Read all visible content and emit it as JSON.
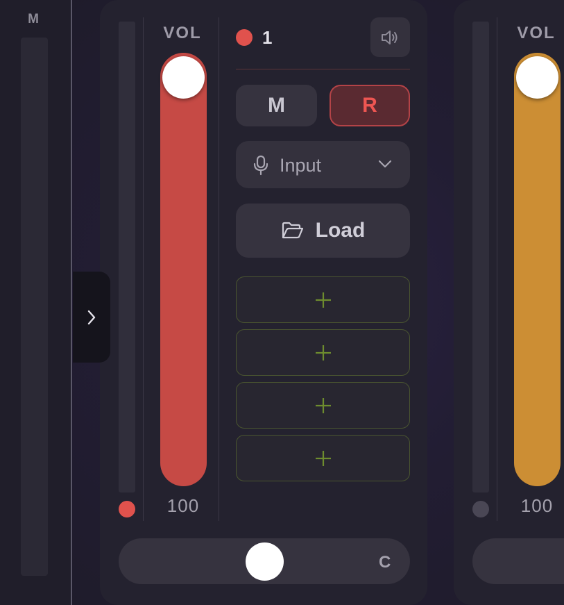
{
  "colors": {
    "channel_1": "#e0524d",
    "channel_1_fader": "#c64a45",
    "channel_2_fader": "#cc8e34",
    "record_active": "#ee5652",
    "slot_plus": "#6e8c2e"
  },
  "master": {
    "label": "M"
  },
  "channels": [
    {
      "number": "1",
      "vol_label": "VOL",
      "volume": "100",
      "volume_fraction": 1.0,
      "pan_label": "C",
      "mute_label": "M",
      "record_label": "R",
      "record_armed": true,
      "input": {
        "label": "Input",
        "icon": "microphone-icon"
      },
      "load": {
        "label": "Load",
        "icon": "folder-open-icon"
      },
      "slots": [
        {
          "icon": "plus-icon"
        },
        {
          "icon": "plus-icon"
        },
        {
          "icon": "plus-icon"
        },
        {
          "icon": "plus-icon"
        }
      ],
      "speaker_icon": "speaker-icon"
    },
    {
      "vol_label": "VOL",
      "volume": "100",
      "volume_fraction": 1.0
    }
  ]
}
